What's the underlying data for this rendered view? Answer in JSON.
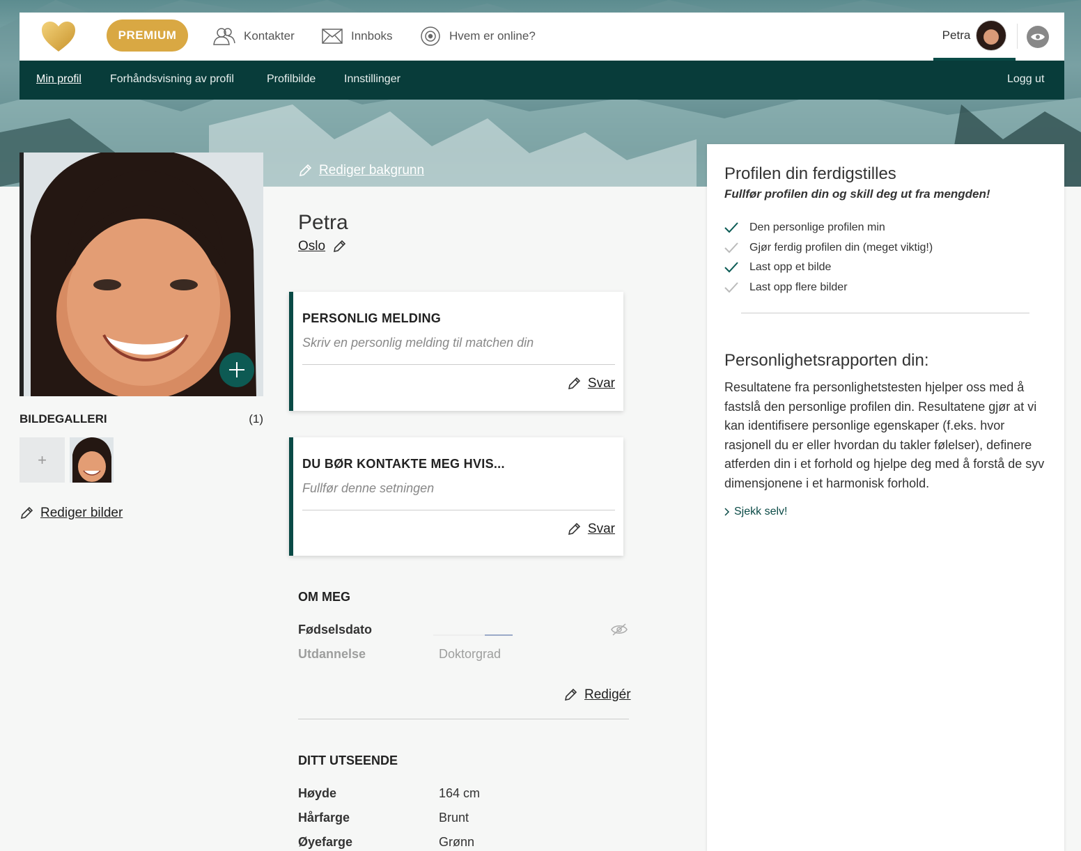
{
  "topbar": {
    "premium_label": "PREMIUM",
    "nav": [
      {
        "label": "Kontakter",
        "icon": "contacts-icon"
      },
      {
        "label": "Innboks",
        "icon": "envelope-icon"
      },
      {
        "label": "Hvem er online?",
        "icon": "online-icon"
      }
    ],
    "user_name": "Petra"
  },
  "subnav": {
    "items": [
      "Min profil",
      "Forhåndsvisning av profil",
      "Profilbilde",
      "Innstillinger"
    ],
    "logout": "Logg ut"
  },
  "left": {
    "gallery_title": "BILDEGALLERI",
    "gallery_count": "(1)",
    "gallery_add": "+",
    "edit_photos": "Rediger bilder"
  },
  "center": {
    "edit_background": "Rediger bakgrunn",
    "name": "Petra",
    "city": "Oslo",
    "card1": {
      "title": "PERSONLIG MELDING",
      "placeholder": "Skriv en personlig melding til matchen din",
      "action": "Svar"
    },
    "card2": {
      "title": "DU BØR KONTAKTE MEG HVIS...",
      "placeholder": "Fullfør denne setningen",
      "action": "Svar"
    },
    "about": {
      "title": "OM MEG",
      "rows": [
        {
          "key": "Fødselsdato",
          "value": ""
        },
        {
          "key": "Utdannelse",
          "value": "Doktorgrad"
        }
      ],
      "edit": "Redigér"
    },
    "looks": {
      "title": "DITT UTSEENDE",
      "rows": [
        {
          "key": "Høyde",
          "value": "164 cm"
        },
        {
          "key": "Hårfarge",
          "value": "Brunt"
        },
        {
          "key": "Øyefarge",
          "value": "Grønn"
        }
      ]
    }
  },
  "side": {
    "title": "Profilen din ferdigstilles",
    "subtitle": "Fullfør profilen din og skill deg ut fra mengden!",
    "checks": [
      {
        "label": "Den personlige profilen min",
        "done": true
      },
      {
        "label": "Gjør ferdig profilen din (meget viktig!)",
        "done": false
      },
      {
        "label": "Last opp et bilde",
        "done": true
      },
      {
        "label": "Last opp flere bilder",
        "done": false
      }
    ],
    "report_title": "Personlighetsrapporten din:",
    "report_body": "Resultatene fra personlighetstesten hjelper oss med å fastslå den personlige profilen din. Resultatene gjør at vi kan identifisere personlige egenskaper (f.eks. hvor rasjonell du er eller hvordan du takler følelser), definere atferden din i et forhold og hjelpe deg med å forstå de syv dimensjonene i et harmonisk forhold.",
    "report_link": "Sjekk selv!"
  },
  "colors": {
    "accent": "#0a4a46",
    "premium": "#d9a843",
    "check_done": "#0a5a54",
    "check_todo": "#bbbbbb"
  }
}
